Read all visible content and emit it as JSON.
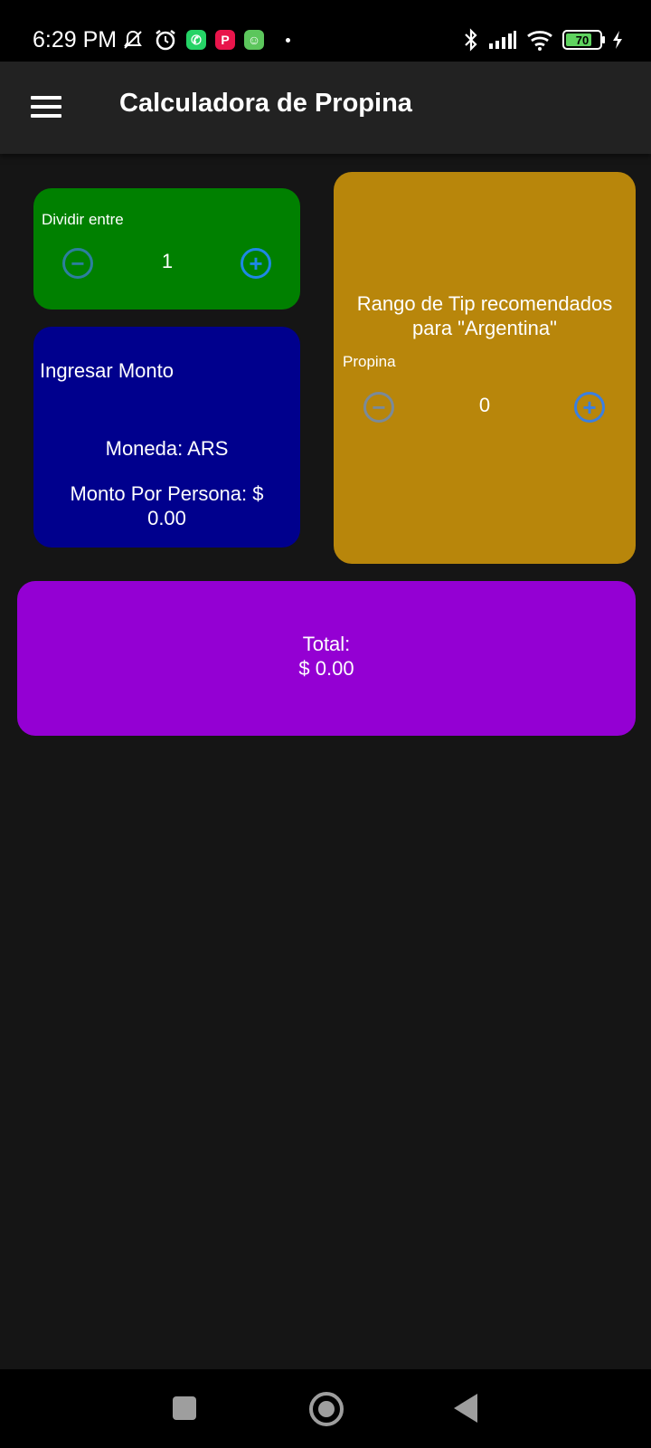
{
  "status_bar": {
    "time": "6:29 PM",
    "battery": "70",
    "icons_left": [
      "mute-alert-icon",
      "alarm-icon",
      "whatsapp-icon",
      "p-app-icon",
      "android-app-icon",
      "dot-icon"
    ],
    "icons_right": [
      "bluetooth-icon",
      "signal-icon",
      "wifi-icon",
      "battery-icon",
      "charging-icon"
    ]
  },
  "app_bar": {
    "title": "Calculadora de Propina",
    "menu_icon": "hamburger-menu-icon"
  },
  "split_card": {
    "label": "Dividir entre",
    "value": "1",
    "color": "#008000"
  },
  "amount_card": {
    "label": "Ingresar Monto",
    "currency": "Moneda: ARS",
    "per_person_line1": "Monto Por Persona: $",
    "per_person_line2": "0.00",
    "color": "#00008d"
  },
  "tip_card": {
    "heading_line1": "Rango de Tip recomendados",
    "heading_line2": "para \"Argentina\"",
    "label": "Propina",
    "value": "0",
    "color": "#b8860b"
  },
  "total_card": {
    "label": "Total:",
    "value": "$ 0.00",
    "color": "#9400d3"
  },
  "nav_bar": {
    "buttons": [
      "recents-square-icon",
      "home-circle-icon",
      "back-triangle-icon"
    ]
  }
}
